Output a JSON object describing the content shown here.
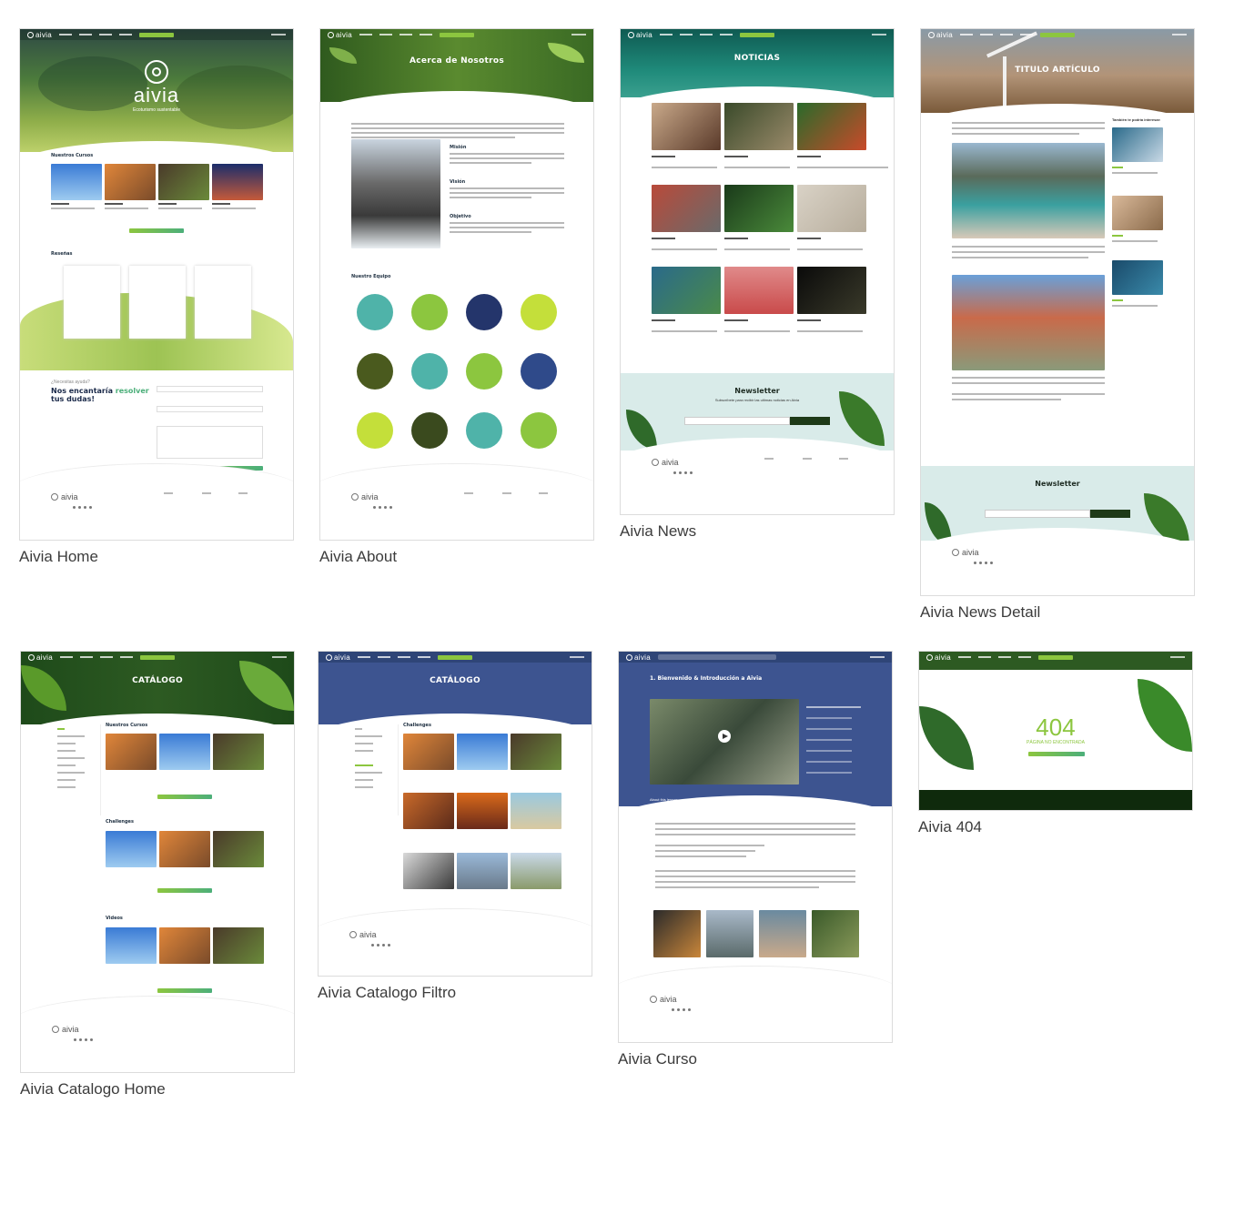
{
  "thumbnails": [
    {
      "id": "home",
      "caption": "Aivia Home"
    },
    {
      "id": "about",
      "caption": "Aivia About"
    },
    {
      "id": "news",
      "caption": "Aivia News"
    },
    {
      "id": "news_detail",
      "caption": "Aivia News Detail"
    },
    {
      "id": "catalog_home",
      "caption": "Aivia Catalogo Home"
    },
    {
      "id": "catalog_filter",
      "caption": "Aivia Catalogo Filtro"
    },
    {
      "id": "course",
      "caption": "Aivia Curso"
    },
    {
      "id": "not_found",
      "caption": "Aivia 404"
    }
  ],
  "mock": {
    "brand": "aivia",
    "home": {
      "brand_big": "aivia",
      "tagline": "Ecoturismo sustentable",
      "courses_title": "Nuestros Cursos",
      "reviews_title": "Reseñas",
      "contact_kicker": "¿Necesitas ayuda?",
      "contact_title_a": "Nos encantaría ",
      "contact_title_b": "resolver",
      "contact_title_c": "tus dudas!"
    },
    "about": {
      "hero_title": "Acerca de Nosotros",
      "mission": "Misión",
      "vision": "Visión",
      "objective": "Objetivo",
      "team_title": "Nuestro Equipo"
    },
    "news": {
      "hero_title": "NOTICIAS",
      "newsletter_title": "Newsletter",
      "newsletter_sub": "Subscríbete para recibir las ultimas noticias en Aivia"
    },
    "news_detail": {
      "hero_title": "TITULO ARTÍCULO",
      "sidebar_title": "También te podría interesar:",
      "newsletter_title": "Newsletter"
    },
    "catalog_home": {
      "hero_title": "CATÁLOGO",
      "s1": "Nuestros Cursos",
      "s2": "Challenges",
      "s3": "Videos"
    },
    "catalog_filter": {
      "hero_title": "CATÁLOGO",
      "s1": "Challenges"
    },
    "course": {
      "title": "1. Bienvenido & Introducción a Aivia",
      "about": "About this lesson"
    },
    "not_found": {
      "code": "404",
      "message": "PÁGINA NO ENCONTRADA"
    }
  },
  "colors": {
    "accent_green": "#8cc63f",
    "dark_green": "#1e3a18",
    "navy": "#3d5490",
    "mint": "#d9ebe9"
  }
}
